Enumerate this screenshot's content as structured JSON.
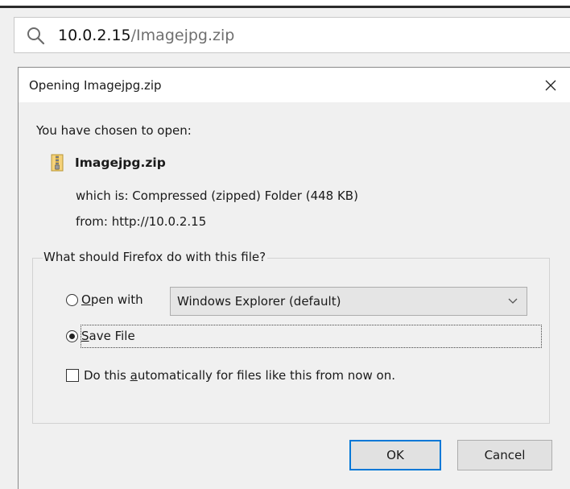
{
  "browser": {
    "url_host": "10.0.2.15",
    "url_path": "/Imagejpg.zip"
  },
  "dialog": {
    "title": "Opening Imagejpg.zip",
    "close_glyph": "✕",
    "chosen_label": "You have chosen to open:",
    "file_name": "Imagejpg.zip",
    "which_label": "which is:",
    "which_value": "Compressed (zipped) Folder (448 KB)",
    "from_label": "from:",
    "from_value": "http://10.0.2.15",
    "group_label": "What should Firefox do with this file?",
    "open_with": {
      "access_key": "O",
      "label_rest": "pen with",
      "selected": false,
      "app": "Windows Explorer (default)"
    },
    "save_file": {
      "access_key": "S",
      "label_rest": "ave File",
      "selected": true
    },
    "auto": {
      "label_pre": "Do this ",
      "access_key": "a",
      "label_rest": "utomatically for files like this from now on.",
      "checked": false
    },
    "ok_label": "OK",
    "cancel_label": "Cancel"
  },
  "icons": {
    "search": "search-icon",
    "zip": "zip-file-icon",
    "close": "close-icon",
    "dropdown": "chevron-down-icon"
  }
}
